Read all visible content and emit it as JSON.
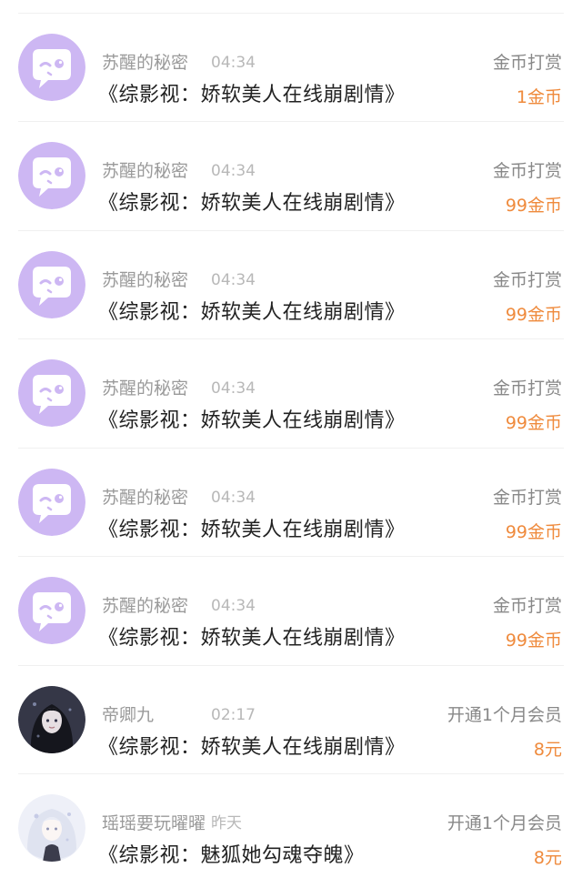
{
  "colors": {
    "accent": "#ef8a3c",
    "avatar_purple": "#cdb7f3",
    "name_gray": "#9a9a9a",
    "time_gray": "#b8b8b8",
    "title_black": "#222222"
  },
  "items": [
    {
      "avatar": "purple-chat-bubble-icon",
      "user": "苏醒的秘密",
      "time": "04:34",
      "book": "《综影视：娇软美人在线崩剧情》",
      "action": "金币打赏",
      "amount": "1金币"
    },
    {
      "avatar": "purple-chat-bubble-icon",
      "user": "苏醒的秘密",
      "time": "04:34",
      "book": "《综影视：娇软美人在线崩剧情》",
      "action": "金币打赏",
      "amount": "99金币"
    },
    {
      "avatar": "purple-chat-bubble-icon",
      "user": "苏醒的秘密",
      "time": "04:34",
      "book": "《综影视：娇软美人在线崩剧情》",
      "action": "金币打赏",
      "amount": "99金币"
    },
    {
      "avatar": "purple-chat-bubble-icon",
      "user": "苏醒的秘密",
      "time": "04:34",
      "book": "《综影视：娇软美人在线崩剧情》",
      "action": "金币打赏",
      "amount": "99金币"
    },
    {
      "avatar": "purple-chat-bubble-icon",
      "user": "苏醒的秘密",
      "time": "04:34",
      "book": "《综影视：娇软美人在线崩剧情》",
      "action": "金币打赏",
      "amount": "99金币"
    },
    {
      "avatar": "purple-chat-bubble-icon",
      "user": "苏醒的秘密",
      "time": "04:34",
      "book": "《综影视：娇软美人在线崩剧情》",
      "action": "金币打赏",
      "amount": "99金币"
    },
    {
      "avatar": "dark-haired-girl-photo",
      "user": "帝卿九",
      "time": "02:17",
      "book": "《综影视：娇软美人在线崩剧情》",
      "action": "开通1个月会员",
      "amount": "8元"
    },
    {
      "avatar": "light-anime-girl-photo",
      "user": "瑶瑶要玩曜曜",
      "time": "昨天",
      "book": "《综影视：魅狐她勾魂夺魄》",
      "action": "开通1个月会员",
      "amount": "8元"
    }
  ]
}
